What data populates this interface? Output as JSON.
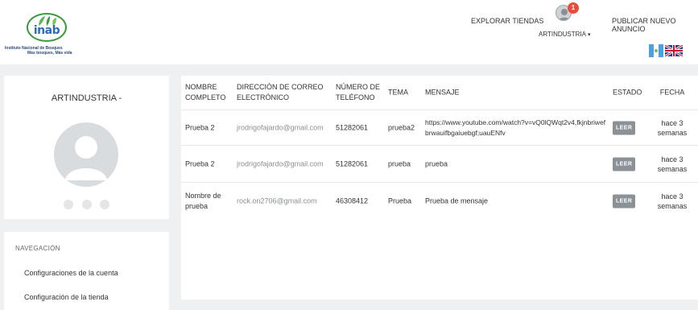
{
  "header": {
    "logo_text": "inab",
    "logo_tagline_1": "Instituto Nacional de Bosques",
    "logo_tagline_2": "Más bosques, Más vida",
    "explore_label": "EXPLORAR TIENDAS",
    "notification_count": "1",
    "user_label": "ARTINDUSTRIA",
    "user_caret": "▾",
    "publish_label": "PUBLICAR NUEVO ANUNCIO",
    "flags": [
      "guatemala-flag",
      "uk-flag"
    ]
  },
  "profile": {
    "name": "ARTINDUSTRIA -"
  },
  "sidebar": {
    "heading": "NAVEGACIÓN",
    "items": [
      {
        "label": "Configuraciones de la cuenta"
      },
      {
        "label": "Configuración de la tienda"
      }
    ]
  },
  "table": {
    "columns": [
      "NOMBRE COMPLETO",
      "DIRECCIÓN DE CORREO ELECTRÓNICO",
      "NÚMERO DE TELÉFONO",
      "TEMA",
      "MENSAJE",
      "ESTADO",
      "FECHA"
    ],
    "rows": [
      {
        "name": "Prueba 2",
        "email": "jrodrigofajardo@gmail.com",
        "phone": "51282061",
        "topic": "prueba2",
        "message": "https://www.youtube.com/watch?v=vQ0lQWqt2v4,fkjnbriwefbrwauifbgaiuebgf;uauENfv",
        "status": "LEER",
        "date": "hace 3 semanas"
      },
      {
        "name": "Prueba 2",
        "email": "jrodrigofajardo@gmail.com",
        "phone": "51282061",
        "topic": "prueba",
        "message": "prueba",
        "status": "LEER",
        "date": "hace 3 semanas"
      },
      {
        "name": "Nombre de prueba",
        "email": "rock.on2706@gmail.com",
        "phone": "46308412",
        "topic": "Prueba",
        "message": "Prueba de mensaje",
        "status": "LEER",
        "date": "hace 3 semanas"
      }
    ]
  },
  "colors": {
    "badge": "#e74c3c",
    "status_button": "#8a9197",
    "logo_green": "#3a9a3a",
    "logo_blue": "#2e6bb5"
  }
}
